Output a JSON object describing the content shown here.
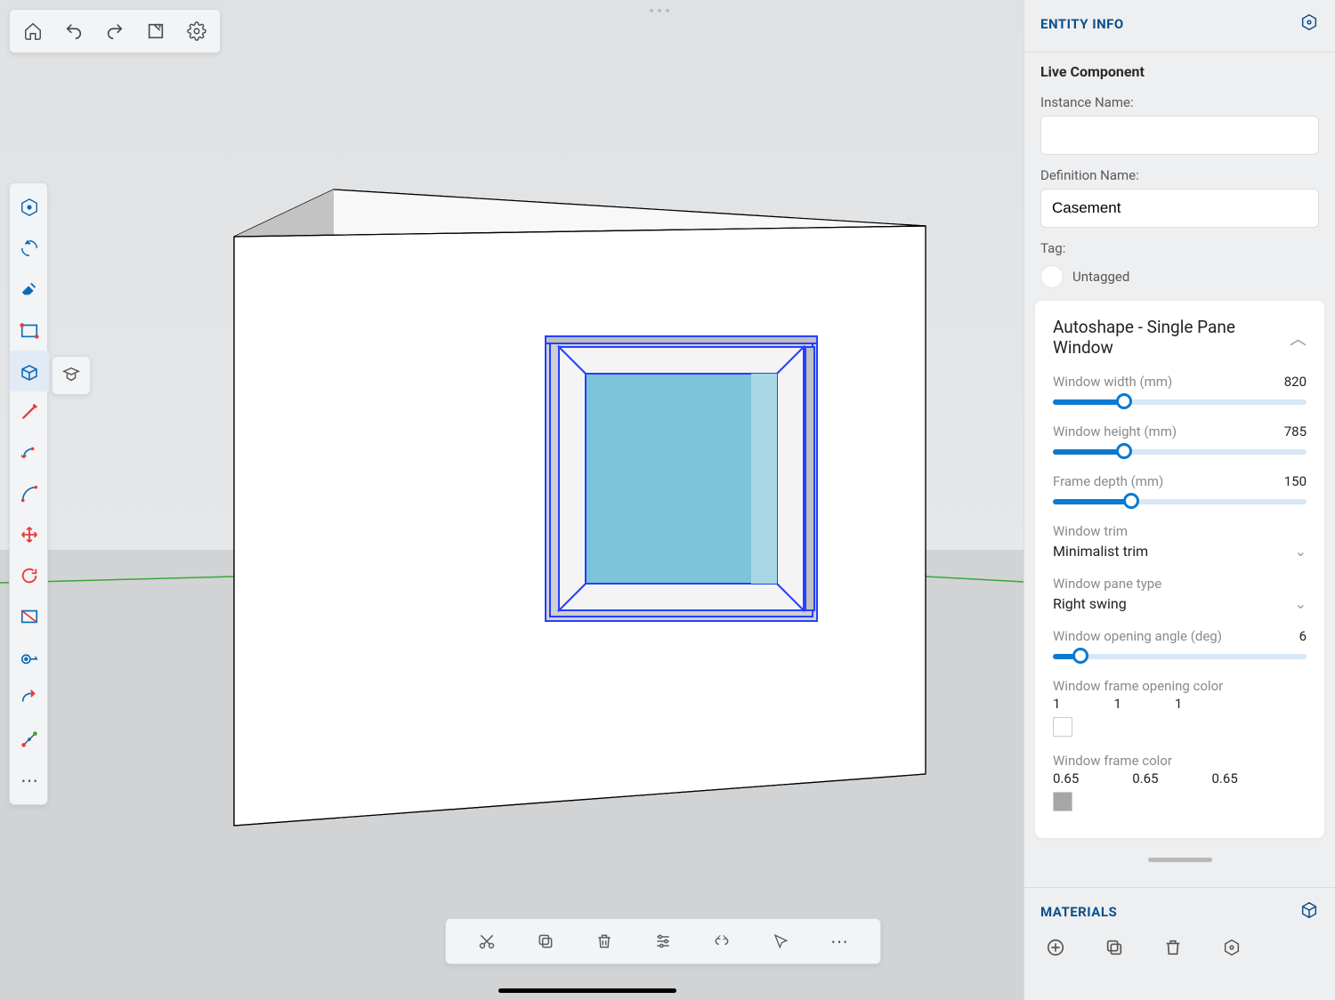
{
  "right_panel": {
    "entity_info_title": "ENTITY INFO",
    "live_component_label": "Live Component",
    "instance_name_label": "Instance Name:",
    "instance_name_value": "",
    "definition_name_label": "Definition Name:",
    "definition_name_value": "Casement",
    "tag_label": "Tag:",
    "tag_value": "Untagged",
    "autoshape_title": "Autoshape - Single Pane Window",
    "params": {
      "window_width": {
        "label": "Window width (mm)",
        "value": "820",
        "fill": 28
      },
      "window_height": {
        "label": "Window height (mm)",
        "value": "785",
        "fill": 28
      },
      "frame_depth": {
        "label": "Frame depth (mm)",
        "value": "150",
        "fill": 31
      },
      "window_trim": {
        "label": "Window trim",
        "value": "Minimalist trim"
      },
      "window_pane_type": {
        "label": "Window pane type",
        "value": "Right swing"
      },
      "window_opening_angle": {
        "label": "Window opening angle (deg)",
        "value": "6",
        "fill": 11
      },
      "frame_opening_color": {
        "label": "Window frame opening color",
        "r": "1",
        "g": "1",
        "b": "1",
        "hex": "#ffffff"
      },
      "frame_color": {
        "label": "Window frame color",
        "r": "0.65",
        "g": "0.65",
        "b": "0.65",
        "hex": "#a6a6a6"
      }
    },
    "materials_title": "MATERIALS"
  },
  "colors": {
    "brand_blue": "#0b4f8c",
    "selection_blue": "#2540ff"
  }
}
